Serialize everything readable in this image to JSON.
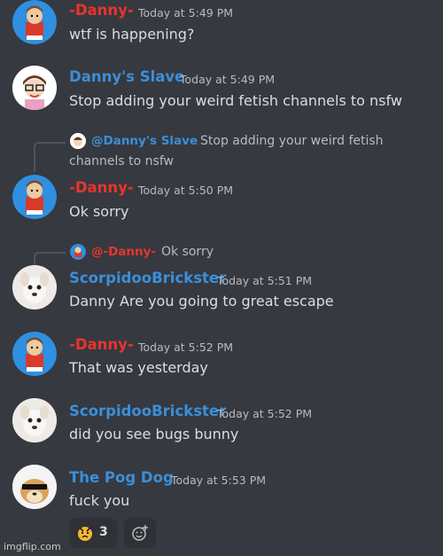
{
  "colors": {
    "background": "#36393f",
    "danny": "#e9342c",
    "blue_name": "#3b8fd9",
    "timestamp": "#b9bbbe",
    "message_text": "#dcddde"
  },
  "messages": [
    {
      "author": "-Danny-",
      "time": "Today at 5:49 PM",
      "text": "wtf is happening?"
    },
    {
      "author": "Danny's Slave",
      "time": "Today at 5:49 PM",
      "text": "Stop adding your weird fetish channels to nsfw"
    },
    {
      "reply_to": "@Danny's Slave",
      "reply_text_1": "Stop adding your weird fetish",
      "reply_text_2": "channels to nsfw",
      "author": "-Danny-",
      "time": "Today at 5:50 PM",
      "text": "Ok sorry"
    },
    {
      "reply_to": "@-Danny-",
      "reply_text": "Ok sorry",
      "author": "ScorpidooBrickster",
      "time": "Today at 5:51 PM",
      "text": "Danny Are you going to great escape"
    },
    {
      "author": "-Danny-",
      "time": "Today at 5:52 PM",
      "text": "That was yesterday"
    },
    {
      "author": "ScorpidooBrickster",
      "time": "Today at 5:52 PM",
      "text": "did you see bugs bunny"
    },
    {
      "author": "The Pog Dog",
      "time": "Today at 5:53 PM",
      "text": "fuck you"
    }
  ],
  "reaction": {
    "emoji": "angry-face-icon",
    "count": "3"
  },
  "add_reaction_icon": "add-reaction-icon",
  "watermark": "imgflip.com"
}
